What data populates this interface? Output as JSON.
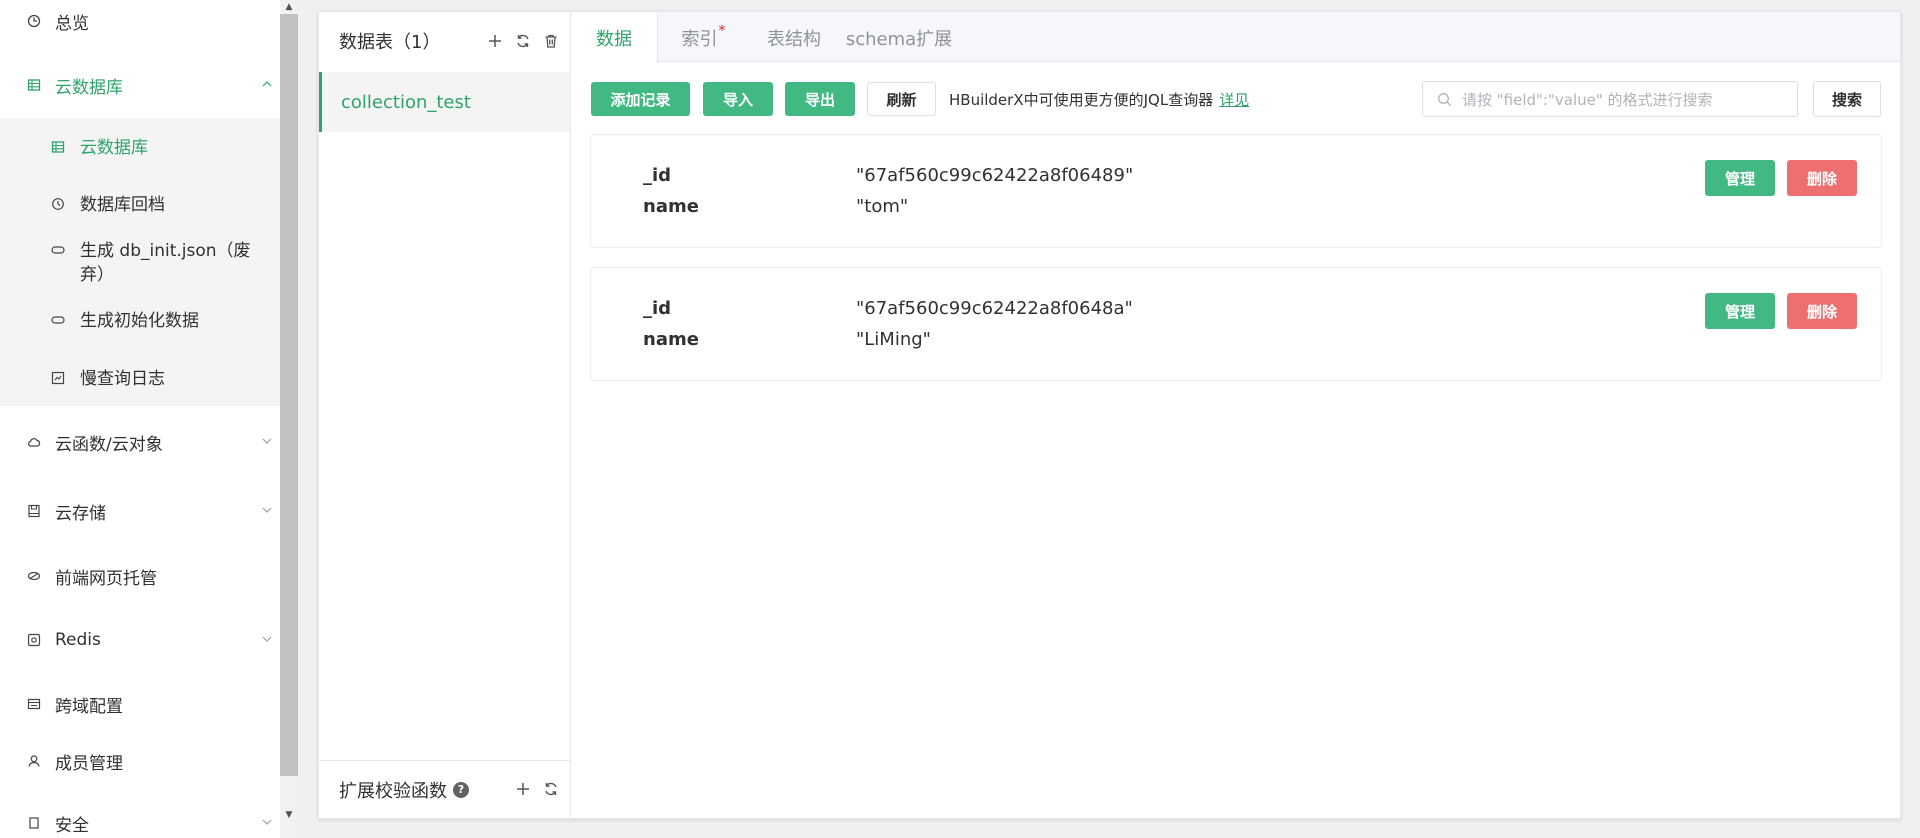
{
  "sidebar": {
    "items": [
      {
        "label": "总览",
        "icon": "dashboard-icon"
      },
      {
        "label": "云数据库",
        "icon": "database-icon"
      },
      {
        "label": "云函数/云对象",
        "icon": "cloud-icon"
      },
      {
        "label": "云存储",
        "icon": "storage-icon"
      },
      {
        "label": "前端网页托管",
        "icon": "hosting-icon"
      },
      {
        "label": "Redis",
        "icon": "redis-icon"
      },
      {
        "label": "跨域配置",
        "icon": "cors-icon"
      },
      {
        "label": "成员管理",
        "icon": "user-icon"
      },
      {
        "label": "安全",
        "icon": "security-icon"
      }
    ],
    "submenu": [
      {
        "label": "云数据库",
        "icon": "table-icon"
      },
      {
        "label": "数据库回档",
        "icon": "rollback-icon"
      },
      {
        "label": "生成 db_init.json（废弃）",
        "icon": "link-icon"
      },
      {
        "label": "生成初始化数据",
        "icon": "link-icon"
      },
      {
        "label": "慢查询日志",
        "icon": "log-icon"
      }
    ]
  },
  "table_panel": {
    "header": "数据表（1）",
    "collections": [
      "collection_test"
    ],
    "footer": "扩展校验函数"
  },
  "tabs": [
    {
      "label": "数据",
      "active": true
    },
    {
      "label": "索引",
      "star": "*"
    },
    {
      "label": "表结构"
    },
    {
      "label": "schema扩展"
    }
  ],
  "toolbar": {
    "add_label": "添加记录",
    "import_label": "导入",
    "export_label": "导出",
    "refresh_label": "刷新",
    "hint": "HBuilderX中可使用更方便的JQL查询器",
    "hint_link": "详见",
    "search_placeholder": "请按 \"field\":\"value\" 的格式进行搜索",
    "search_label": "搜索"
  },
  "records": [
    {
      "id_key": "_id",
      "id_val": "\"67af560c99c62422a8f06489\"",
      "name_key": "name",
      "name_val": "\"tom\""
    },
    {
      "id_key": "_id",
      "id_val": "\"67af560c99c62422a8f0648a\"",
      "name_key": "name",
      "name_val": "\"LiMing\""
    }
  ],
  "record_actions": {
    "manage": "管理",
    "delete": "删除"
  },
  "colors": {
    "accent": "#42b983",
    "danger": "#ee6f6f",
    "active_text": "#2fa36b"
  }
}
